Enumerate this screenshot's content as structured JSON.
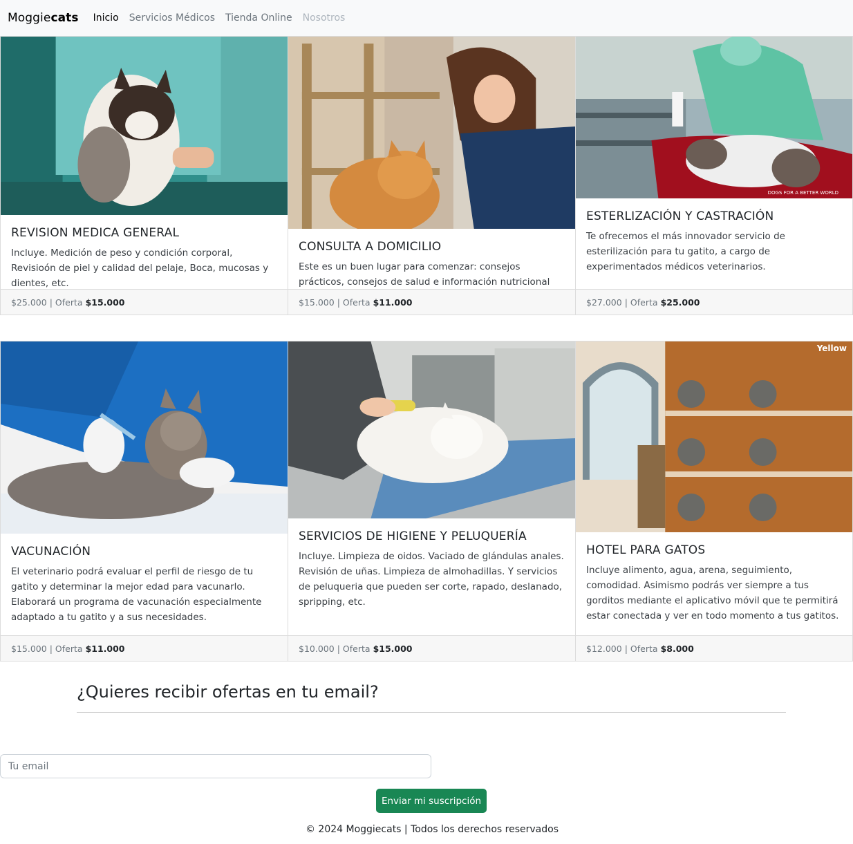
{
  "navbar": {
    "brand_normal": "Moggie",
    "brand_bold": "cats",
    "links": [
      "Inicio",
      "Servicios Médicos",
      "Tienda Online",
      "Nosotros"
    ]
  },
  "cards": [
    {
      "title": "REVISION MEDICA GENERAL",
      "text": "Incluye. Medición de peso y condición corporal, Revisioón de piel y calidad del pelaje, Boca, mucosas y dientes, etc.",
      "price": "$25.000",
      "offer_label": "Oferta",
      "offer_price": "$15.000"
    },
    {
      "title": "CONSULTA A DOMICILIO",
      "text": "Este es un buen lugar para comenzar: consejos prácticos, consejos de salud e información nutricional para darle a su mascota lo mejor desde la seguridad de tu hogar.",
      "price": "$15.000",
      "offer_label": "Oferta",
      "offer_price": "$11.000"
    },
    {
      "title": "ESTERLIZACIÓN Y CASTRACIÓN",
      "text": "Te ofrecemos el más innovador servicio de esterilización para tu gatito, a cargo de experimentados médicos veterinarios.",
      "price": "$27.000",
      "offer_label": "Oferta",
      "offer_price": "$25.000",
      "image_caption": "DOGS FOR A BETTER WORLD"
    },
    {
      "title": "VACUNACIÓN",
      "text": "El veterinario podrá evaluar el perfil de riesgo de tu gatito y determinar la mejor edad para vacunarlo. Elaborará un programa de vacunación especialmente adaptado a tu gatito y a sus necesidades.",
      "price": "$15.000",
      "offer_label": "Oferta",
      "offer_price": "$11.000"
    },
    {
      "title": "SERVICIOS DE HIGIENE Y PELUQUERÍA",
      "text": "Incluye. Limpieza de oidos. Vaciado de glándulas anales. Revisión de uñas. Limpieza de almohadillas. Y servicios de peluqueria que pueden ser corte, rapado, deslanado, spripping, etc.",
      "price": "$10.000",
      "offer_label": "Oferta",
      "offer_price": "$15.000"
    },
    {
      "title": "HOTEL PARA GATOS",
      "text": "Incluye alimento, agua, arena, seguimiento, comodidad. Asimismo podrás ver siempre a tus gorditos mediante el aplicativo móvil que te permitirá estar conectada y ver en todo momento a tus gatitos.",
      "price": "$12.000",
      "offer_label": "Oferta",
      "offer_price": "$8.000",
      "image_caption": "Yellow"
    }
  ],
  "newsletter": {
    "title": "¿Quieres recibir ofertas en tu email?",
    "placeholder": "Tu email",
    "button_label": "Enviar mi suscripción"
  },
  "footer": {
    "text": "© 2024 Moggiecats | Todos los derechos reservados"
  }
}
